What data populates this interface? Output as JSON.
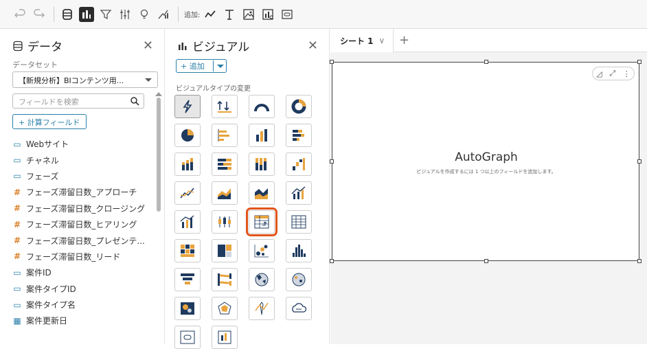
{
  "toolbar": {
    "undo_icon": "undo-icon",
    "redo_icon": "redo-icon",
    "data_icon": "database-icon",
    "visual_icon": "bar-chart-icon",
    "filter_icon": "filter-icon",
    "settings_icon": "sliders-icon",
    "insight_icon": "lightbulb-icon",
    "theme_icon": "brush-chart-icon",
    "add_label": "追加:",
    "add_items": [
      "line-chart-icon",
      "text-icon",
      "image-icon",
      "visual-insight-icon",
      "embed-icon"
    ]
  },
  "data_panel": {
    "title": "データ",
    "dataset_label": "データセット",
    "dataset_value": "【新規分析】BIコンテンツ用...",
    "search_placeholder": "フィールドを検索",
    "calc_field_button": "+ 計算フィールド",
    "fields": [
      {
        "type": "dimension",
        "icon": "▭",
        "label": "Webサイト"
      },
      {
        "type": "dimension",
        "icon": "▭",
        "label": "チャネル"
      },
      {
        "type": "dimension",
        "icon": "▭",
        "label": "フェーズ"
      },
      {
        "type": "measure",
        "icon": "#",
        "label": "フェーズ滞留日数_アプローチ"
      },
      {
        "type": "measure",
        "icon": "#",
        "label": "フェーズ滞留日数_クロージング"
      },
      {
        "type": "measure",
        "icon": "#",
        "label": "フェーズ滞留日数_ヒアリング"
      },
      {
        "type": "measure",
        "icon": "#",
        "label": "フェーズ滞留日数_プレゼンテ..."
      },
      {
        "type": "measure",
        "icon": "#",
        "label": "フェーズ滞留日数_リード"
      },
      {
        "type": "dimension",
        "icon": "▭",
        "label": "案件ID"
      },
      {
        "type": "dimension",
        "icon": "▭",
        "label": "案件タイプID"
      },
      {
        "type": "dimension",
        "icon": "▭",
        "label": "案件タイプ名"
      },
      {
        "type": "dimension",
        "icon": "▦",
        "label": "案件更新日"
      }
    ]
  },
  "visual_panel": {
    "title": "ビジュアル",
    "add_button": "+ 追加",
    "visual_type_label": "ビジュアルタイプの変更",
    "selected_type": "table-icon",
    "types": [
      "autograph",
      "kpi",
      "gauge",
      "donut",
      "pie",
      "horizontal-bar",
      "vertical-bar",
      "stacked-horizontal-bar",
      "stacked-vertical-bar",
      "percent-horizontal-bar",
      "percent-vertical-bar",
      "waterfall",
      "line",
      "area",
      "stacked-area",
      "combo-line",
      "combo-bar",
      "box-plot",
      "table",
      "pivot-table",
      "heatmap",
      "tree-map",
      "scatter",
      "histogram",
      "funnel",
      "sankey",
      "filled-map",
      "points-map",
      "geo-heatmap",
      "radar",
      "insight",
      "word-cloud",
      "custom-content",
      "embed"
    ]
  },
  "canvas": {
    "sheet_tab": "シート 1",
    "visual_title": "AutoGraph",
    "visual_subtitle": "ビジュアルを作成するには 1 つ以上のフィールドを追加します。"
  },
  "colors": {
    "accent": "#2a7fa8",
    "navy": "#1f3a5f",
    "orange": "#e8a33d",
    "highlight": "#e2541b"
  }
}
